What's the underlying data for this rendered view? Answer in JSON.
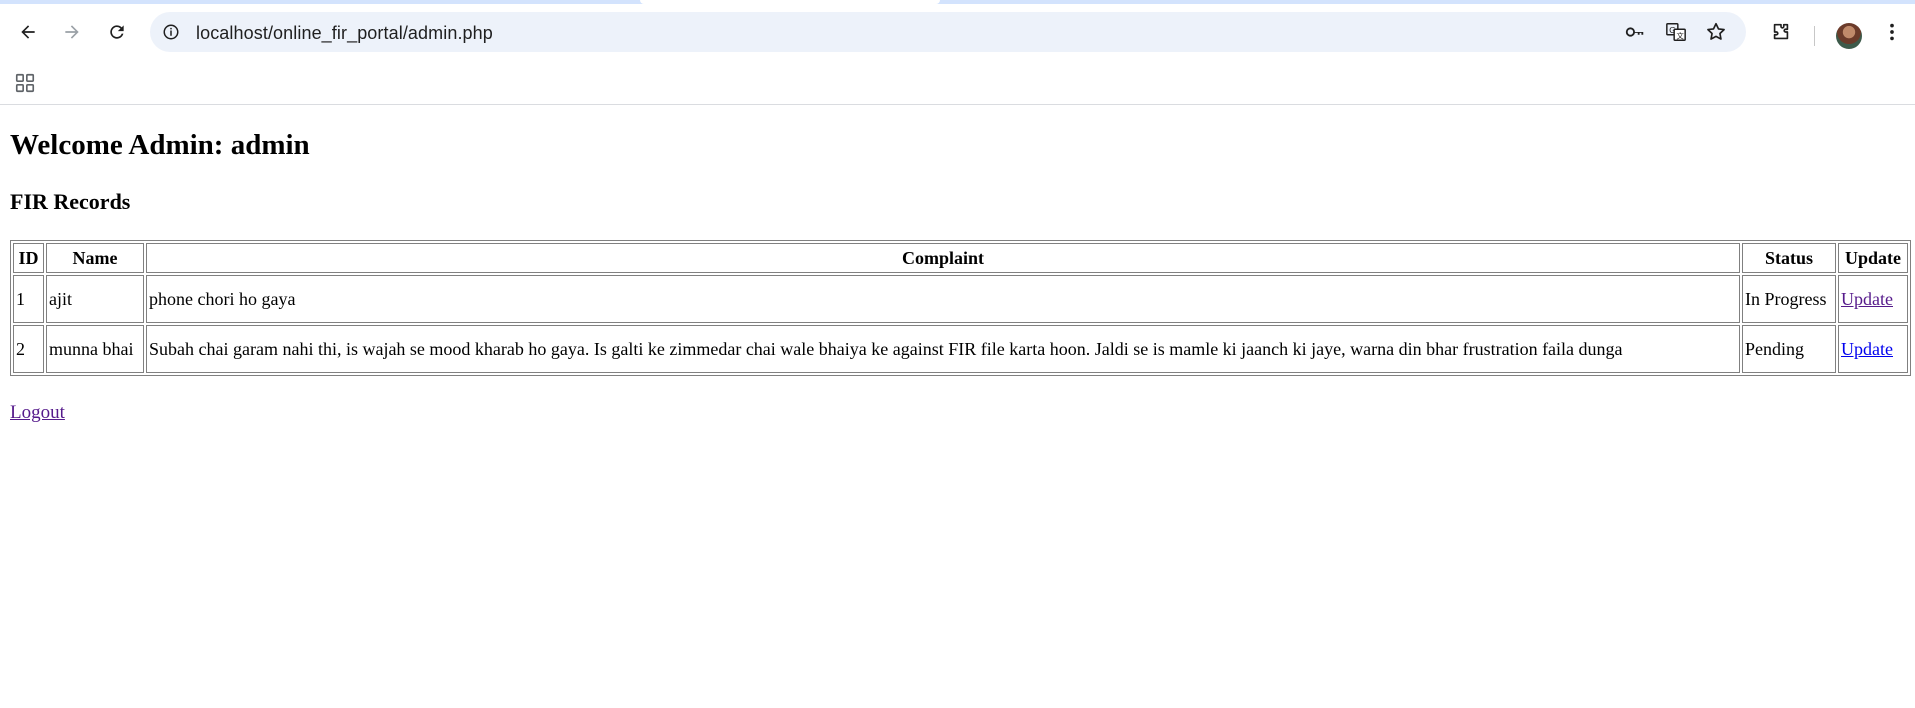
{
  "browser": {
    "url": "localhost/online_fir_portal/admin.php",
    "icons": {
      "back": "back-arrow-icon",
      "forward": "forward-arrow-icon",
      "reload": "reload-icon",
      "site_info": "site-info-icon",
      "password": "key-icon",
      "translate": "translate-icon",
      "bookmark": "star-icon",
      "extensions": "puzzle-icon",
      "profile": "avatar",
      "menu": "kebab-menu-icon",
      "apps": "apps-grid-icon"
    }
  },
  "page": {
    "welcome_heading": "Welcome Admin: admin",
    "records_heading": "FIR Records",
    "table": {
      "headers": [
        "ID",
        "Name",
        "Complaint",
        "Status",
        "Update"
      ],
      "rows": [
        {
          "id": "1",
          "name": "ajit",
          "complaint": "phone chori ho gaya",
          "status": "In Progress",
          "update": "Update"
        },
        {
          "id": "2",
          "name": "munna bhai",
          "complaint": "Subah chai garam nahi thi, is wajah se mood kharab ho gaya. Is galti ke zimmedar chai wale bhaiya ke against FIR file karta hoon. Jaldi se is mamle ki jaanch ki jaye, warna din bhar frustration faila dunga",
          "status": "Pending",
          "update": "Update"
        }
      ]
    },
    "logout_label": "Logout"
  },
  "colors": {
    "link": "#0000ee",
    "visited_link": "#551a8b",
    "omnibox_bg": "#edf2fa",
    "tabstrip_bg": "#d3e3fd"
  }
}
